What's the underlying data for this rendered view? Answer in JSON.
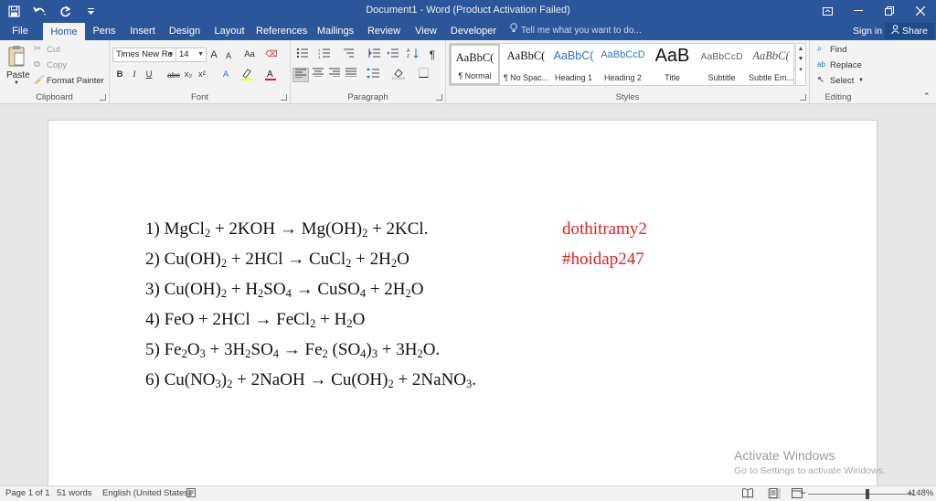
{
  "titlebar": {
    "title": "Document1 - Word (Product Activation Failed)",
    "save_icon": "save-icon",
    "undo_icon": "undo-icon",
    "redo_icon": "redo-icon"
  },
  "tabs": [
    "File",
    "Home",
    "Pens",
    "Insert",
    "Design",
    "Layout",
    "References",
    "Mailings",
    "Review",
    "View",
    "Developer"
  ],
  "tell_me": "Tell me what you want to do...",
  "sign_in": "Sign in",
  "share": "Share",
  "clipboard": {
    "paste": "Paste",
    "cut": "Cut",
    "copy": "Copy",
    "format_painter": "Format Painter",
    "label": "Clipboard"
  },
  "font": {
    "name": "Times New Ro",
    "size": "14",
    "grow": "A",
    "shrink": "A",
    "case": "Aa",
    "bold": "B",
    "italic": "I",
    "underline": "U",
    "strike": "abc",
    "subscript": "x₂",
    "superscript": "x²",
    "label": "Font"
  },
  "paragraph": {
    "label": "Paragraph",
    "pilcrow": "¶"
  },
  "styles": {
    "label": "Styles",
    "items": [
      {
        "preview": "AaBbC(",
        "name": "¶ Normal"
      },
      {
        "preview": "AaBbC(",
        "name": "¶ No Spac..."
      },
      {
        "preview": "AaBbC(",
        "name": "Heading 1"
      },
      {
        "preview": "AaBbCcD",
        "name": "Heading 2"
      },
      {
        "preview": "AaB",
        "name": "Title"
      },
      {
        "preview": "AaBbCcD",
        "name": "Subtitle"
      },
      {
        "preview": "AaBbC(",
        "name": "Subtle Em..."
      }
    ]
  },
  "editing": {
    "find": "Find",
    "replace": "Replace",
    "select": "Select",
    "label": "Editing"
  },
  "document": {
    "lines": [
      "1) MgCl₂ + 2KOH → Mg(OH)₂ + 2KCl.",
      "2) Cu(OH)₂ + 2HCl → CuCl₂ + 2H₂O",
      "3) Cu(OH)₂ + H₂SO₄ → CuSO₄ + 2H₂O",
      "4) FeO + 2HCl → FeCl₂ + H₂O",
      "5) Fe₂O₃ + 3H₂SO₄ → Fe₂ (SO₄)₃ + 3H₂O.",
      "6) Cu(NO₃)₂ + 2NaOH → Cu(OH)₂ + 2NaNO₃."
    ],
    "signature": [
      "dothitramy2",
      "#hoidap247"
    ],
    "signature_color": "#e02020"
  },
  "watermark": {
    "title": "Activate Windows",
    "subtitle": "Go to Settings to activate Windows."
  },
  "status": {
    "page": "Page 1 of 1",
    "words": "51 words",
    "language": "English (United States)",
    "zoom": "148%",
    "zoom_level": 148
  },
  "colors": {
    "accent": "#2b579a",
    "ribbon": "#f3f3f3",
    "canvas": "#e6e6e6"
  }
}
